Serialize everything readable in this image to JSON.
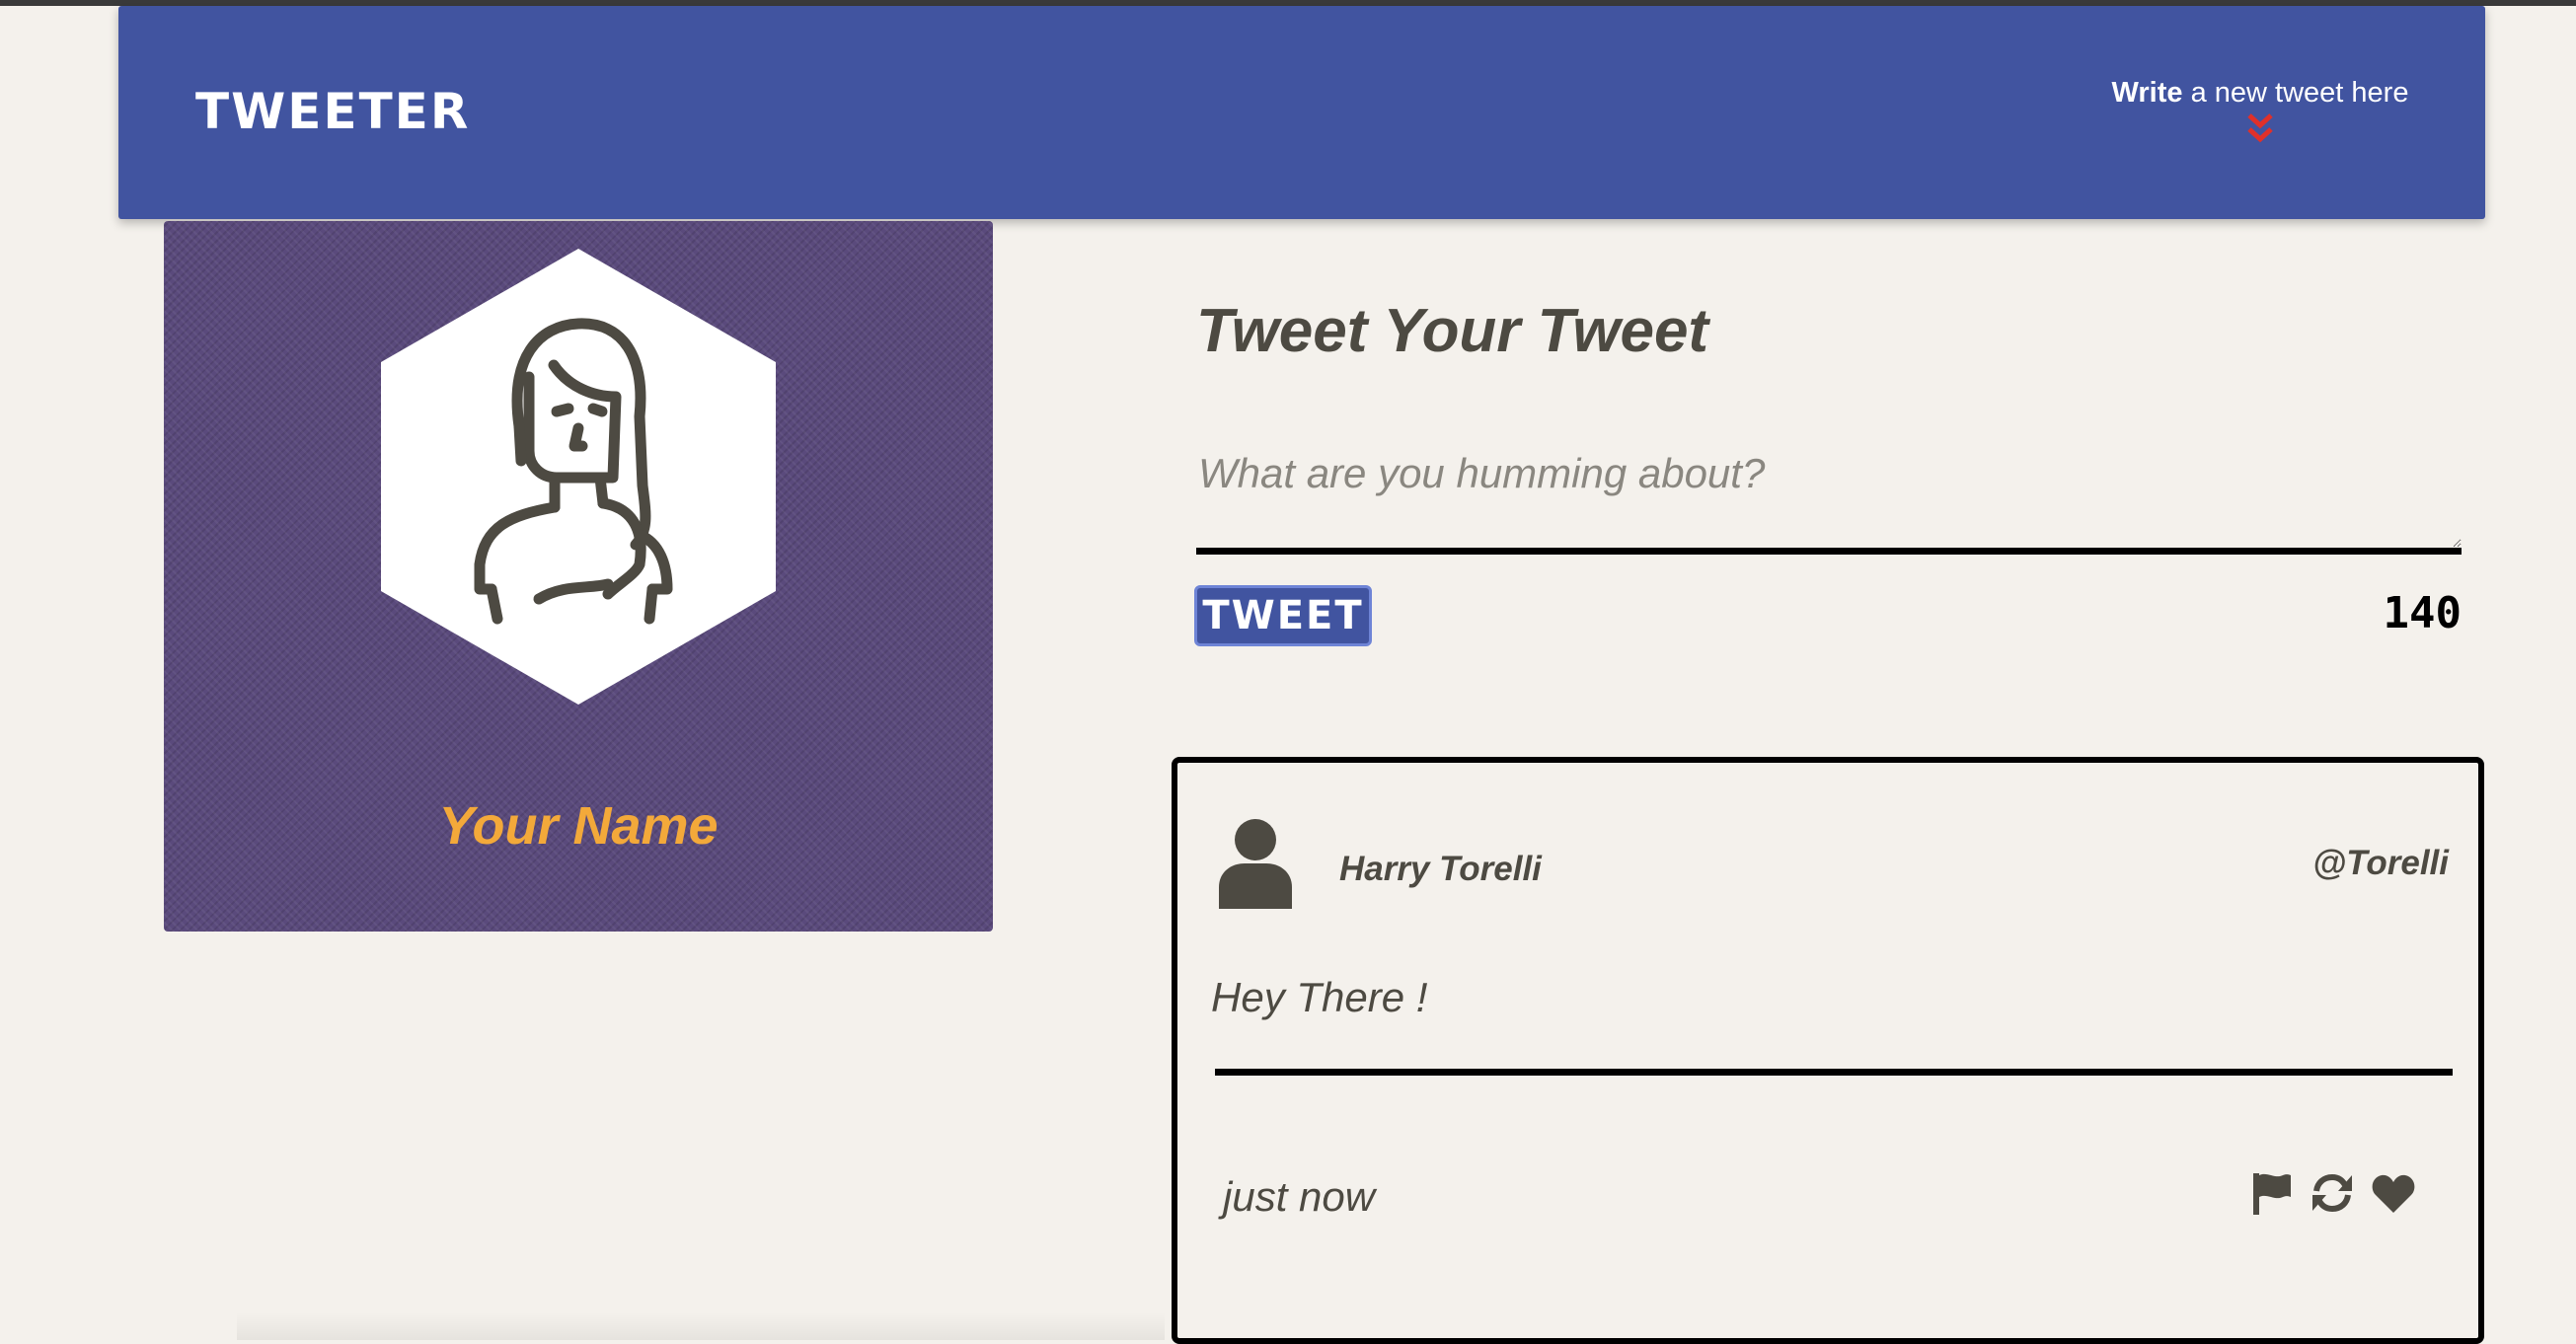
{
  "nav": {
    "brand": "TWEETER",
    "compose_toggle_bold": "Write",
    "compose_toggle_rest": " a new tweet here",
    "chevron_icon": "double-chevron-down-icon",
    "chevron_color": "#e0302a",
    "background_color": "#4154a0"
  },
  "profile": {
    "name": "Your Name",
    "avatar_icon": "user-avatar-icon",
    "name_color": "#f3a93a",
    "background_color": "#5a4a7c"
  },
  "composer": {
    "title": "Tweet Your Tweet",
    "placeholder": "What are you humming about?",
    "button_label": "TWEET",
    "counter": "140"
  },
  "tweets": [
    {
      "author": "Harry Torelli",
      "handle": "@Torelli",
      "body": "Hey There !",
      "timestamp": "just now",
      "avatar_icon": "person-icon",
      "actions": [
        "flag-icon",
        "retweet-icon",
        "heart-icon"
      ]
    }
  ]
}
